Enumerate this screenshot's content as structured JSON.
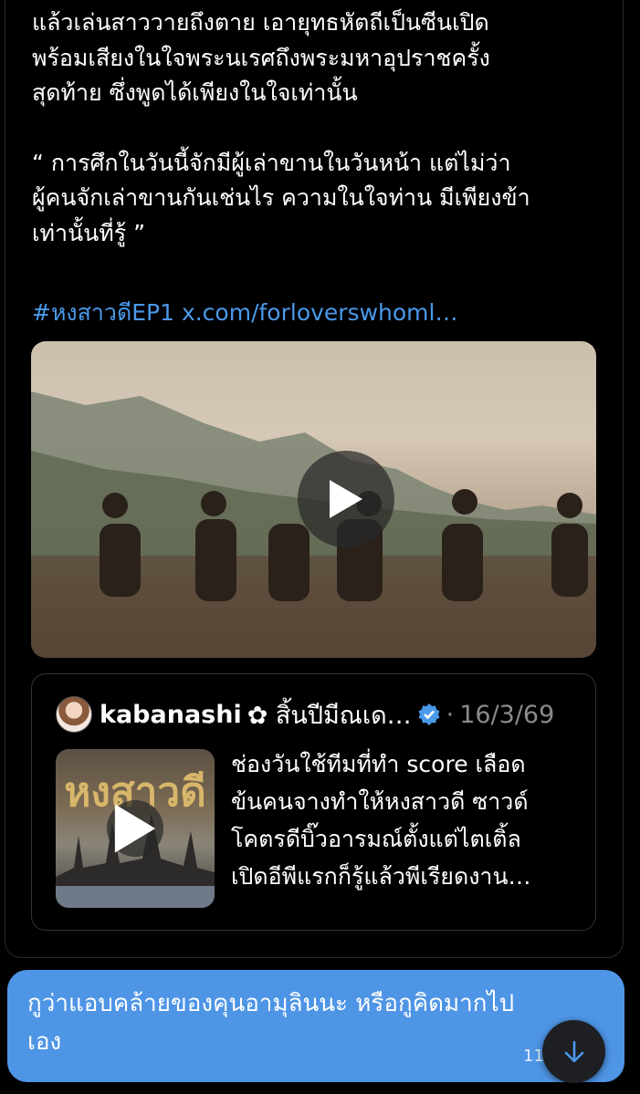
{
  "tweet": {
    "lines": [
      "แล้วเล่นสาววายถึงตาย เอายุทธหัตถีเป็นซีนเปิด",
      "พร้อมเสียงในใจพระนเรศถึงพระมหาอุปราชครั้ง",
      "สุดท้าย ซึ่งพูดได้เพียงในใจเท่านั้น"
    ],
    "quote_lines": [
      "“ การศึกในวันนี้จักมีผู้เล่าขานในวันหน้า แต่ไม่ว่า",
      "ผู้คนจักเล่าขานกันเช่นไร ความในใจท่าน มีเพียงข้า",
      "เท่านั้นที่รู้ ”"
    ],
    "hashtag": "#หงสาวดีEP1",
    "link": "x.com/forloverswhoml…",
    "video_icon": "play-icon"
  },
  "quoted": {
    "username": "kabanashi",
    "display_name": "✿ สิ้นปีมีณเด…",
    "separator": "·",
    "date": "16/3/69",
    "verified_icon": "verified-badge-icon",
    "thumb_title": "หงสาวดี",
    "text_lines": [
      "ช่องวันใช้ทีมที่ทำ score เลือด",
      "ข้นคนจางทำให้หงสาวดี ซาวด์",
      "โคตรดีบิ๊วอารมณ์ตั้งแต่ไตเติ้ล",
      "เปิดอีพีแรกก็รู้แล้วพีเรียดงาน…"
    ]
  },
  "message": {
    "lines": [
      "กูว่าแอบคล้ายของคุนอามุลินนะ หรือกูคิดมากไป",
      "เอง"
    ],
    "time": "11:",
    "bubble_color": "#4e95e6"
  },
  "scroll_button": {
    "icon": "arrow-down-icon"
  },
  "colors": {
    "link": "#4a99e9",
    "verified": "#4a99e9",
    "muted": "#8b8b8b"
  }
}
